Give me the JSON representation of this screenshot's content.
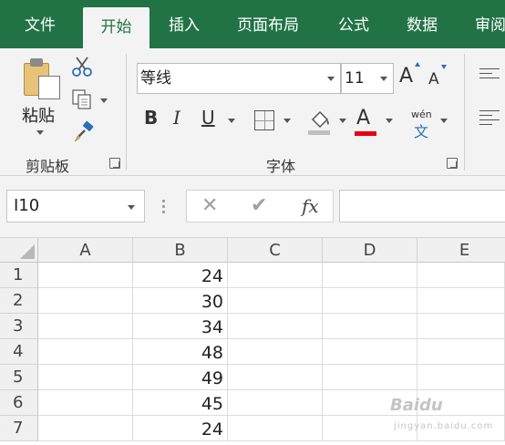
{
  "ribbon": {
    "tabs": [
      "文件",
      "开始",
      "插入",
      "页面布局",
      "公式",
      "数据",
      "审阅"
    ],
    "active_tab": "开始",
    "clipboard": {
      "paste_label": "粘贴",
      "group_label": "剪贴板"
    },
    "font": {
      "font_name": "等线",
      "font_size": "11",
      "grow_label": "A",
      "shrink_label": "A",
      "bold": "B",
      "italic": "I",
      "underline": "U",
      "font_color_label": "A",
      "pinyin_top": "wén",
      "pinyin_bottom": "文",
      "group_label": "字体"
    },
    "colors": {
      "accent": "#217346",
      "font_color": "#e60012",
      "fill_color": "#bfbfbf"
    }
  },
  "formula_bar": {
    "name_box": "I10",
    "fx_label": "fx",
    "formula": ""
  },
  "sheet": {
    "columns": [
      "A",
      "B",
      "C",
      "D",
      "E"
    ],
    "rows": [
      {
        "num": "1",
        "B": "24"
      },
      {
        "num": "2",
        "B": "30"
      },
      {
        "num": "3",
        "B": "34"
      },
      {
        "num": "4",
        "B": "48"
      },
      {
        "num": "5",
        "B": "49"
      },
      {
        "num": "6",
        "B": "45"
      },
      {
        "num": "7",
        "B": "24"
      }
    ]
  },
  "watermark": {
    "name": "Baidu",
    "subtitle": "jingyan.baidu.com"
  }
}
